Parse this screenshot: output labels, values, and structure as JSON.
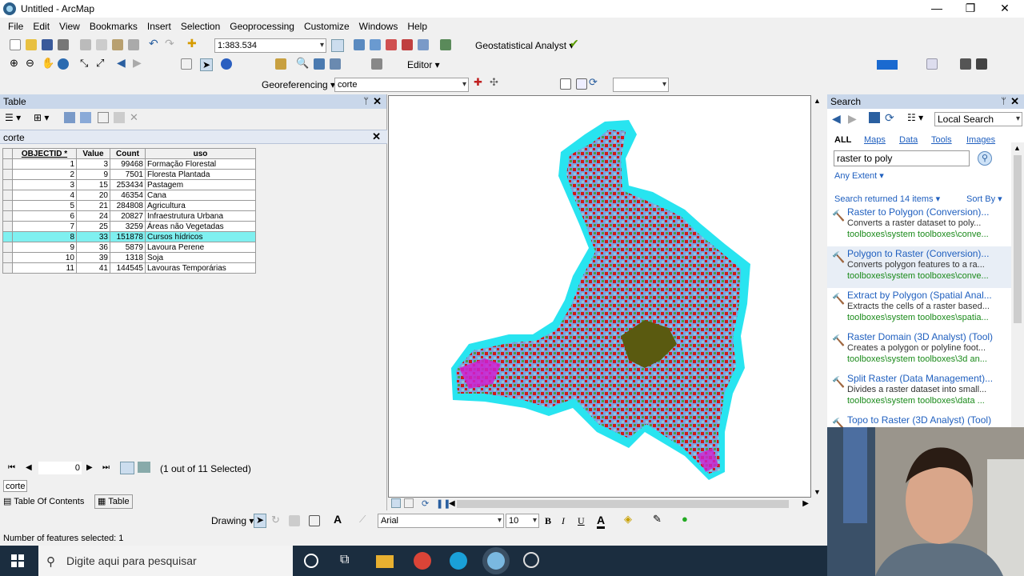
{
  "window": {
    "title": "Untitled - ArcMap",
    "minimize": "—",
    "restore": "❐",
    "close": "✕"
  },
  "menu": [
    "File",
    "Edit",
    "View",
    "Bookmarks",
    "Insert",
    "Selection",
    "Geoprocessing",
    "Customize",
    "Windows",
    "Help"
  ],
  "toolbar": {
    "scale": "1:383.534",
    "geostat": "Geostatistical Analyst ▾",
    "editor": "Editor ▾",
    "georef": "Georeferencing ▾",
    "georef_layer": "corte"
  },
  "table_panel": {
    "title": "Table",
    "pin": "ᛘ",
    "close": "✕",
    "layer": "corte",
    "columns": [
      "OBJECTID *",
      "Value",
      "Count",
      "uso"
    ],
    "rows": [
      [
        "1",
        "3",
        "99468",
        "Formação Florestal"
      ],
      [
        "2",
        "9",
        "7501",
        "Floresta Plantada"
      ],
      [
        "3",
        "15",
        "253434",
        "Pastagem"
      ],
      [
        "4",
        "20",
        "46354",
        "Cana"
      ],
      [
        "5",
        "21",
        "284808",
        "Agricultura"
      ],
      [
        "6",
        "24",
        "20827",
        "Infraestrutura Urbana"
      ],
      [
        "7",
        "25",
        "3259",
        "Áreas não Vegetadas"
      ],
      [
        "8",
        "33",
        "151878",
        "Cursos hídricos"
      ],
      [
        "9",
        "36",
        "5879",
        "Lavoura Perene"
      ],
      [
        "10",
        "39",
        "1318",
        "Soja"
      ],
      [
        "11",
        "41",
        "144545",
        "Lavouras Temporárias"
      ]
    ],
    "selected_row": 8,
    "record": "0",
    "selection_text": "(1 out of 11 Selected)",
    "tab_label": "corte",
    "bottom_tabs": [
      "Table Of Contents",
      "Table"
    ]
  },
  "drawing_toolbar": {
    "drawing": "Drawing ▾",
    "font": "Arial",
    "size": "10",
    "bold": "B",
    "italic": "I",
    "underline": "U",
    "font_color": "A"
  },
  "status": "Number of features selected: 1",
  "search": {
    "title": "Search",
    "scope": "Local Search",
    "tabs": [
      "ALL",
      "Maps",
      "Data",
      "Tools",
      "Images"
    ],
    "query": "raster to poly",
    "extent": "Any Extent ▾",
    "returned": "Search returned 14 items ▾",
    "sort": "Sort By ▾",
    "results": [
      {
        "title": "Raster to Polygon (Conversion)...",
        "desc": "Converts a raster dataset to poly...",
        "path": "toolboxes\\system toolboxes\\conve..."
      },
      {
        "title": "Polygon to Raster (Conversion)...",
        "desc": "Converts polygon features to a ra...",
        "path": "toolboxes\\system toolboxes\\conve..."
      },
      {
        "title": "Extract by Polygon (Spatial Anal...",
        "desc": "Extracts the cells of a raster based...",
        "path": "toolboxes\\system toolboxes\\spatia..."
      },
      {
        "title": "Raster Domain (3D Analyst) (Tool)",
        "desc": "Creates a polygon or polyline foot...",
        "path": "toolboxes\\system toolboxes\\3d an..."
      },
      {
        "title": "Split Raster (Data Management)...",
        "desc": "Divides a raster dataset into small...",
        "path": "toolboxes\\system toolboxes\\data ..."
      },
      {
        "title": "Topo to Raster (3D Analyst) (Tool)",
        "desc": "",
        "path": ""
      }
    ]
  },
  "taskbar": {
    "search_placeholder": "Digite aqui para pesquisar"
  },
  "colors": {
    "panel_header": "#c9d7ea",
    "selection": "#7ff0f0",
    "map_water": "#28e4f0",
    "taskbar": "#1b2d3f"
  }
}
